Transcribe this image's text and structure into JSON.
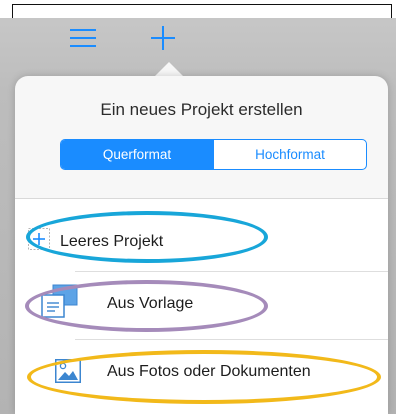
{
  "toolbar": {
    "menu_icon": "hamburger-menu-icon",
    "add_icon": "plus-icon",
    "accent_color": "#1a8cff"
  },
  "popover": {
    "title": "Ein neues Projekt erstellen",
    "orientation": {
      "options": [
        "Querformat",
        "Hochformat"
      ],
      "selected": "Querformat"
    },
    "items": [
      {
        "label": "Leeres Projekt",
        "icon": "blank-project-plus-icon"
      },
      {
        "label": "Aus Vorlage",
        "icon": "template-icon"
      },
      {
        "label": "Aus Fotos oder Dokumenten",
        "icon": "photo-icon"
      }
    ]
  },
  "annotations": {
    "colors": [
      "#18a6d9",
      "#a58bba",
      "#f2b91a"
    ]
  }
}
